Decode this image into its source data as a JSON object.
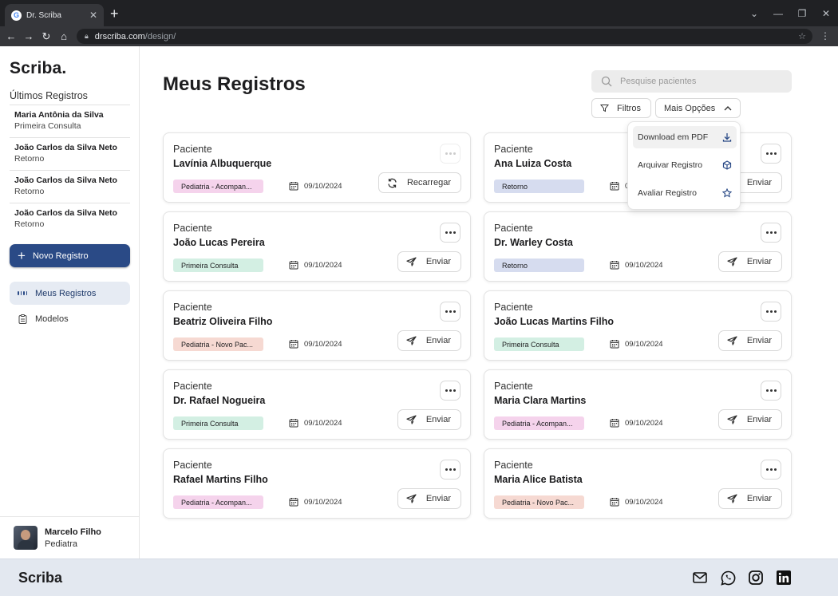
{
  "browser": {
    "tab_title": "Dr. Scriba",
    "tab_favicon": "G",
    "url_domain": "drscriba.com",
    "url_path": "/design/"
  },
  "sidebar": {
    "brand": "Scriba.",
    "recent_title": "Últimos Registros",
    "recent": [
      {
        "name": "Maria Antônia da Silva",
        "sub": "Primeira Consulta"
      },
      {
        "name": "João Carlos da Silva Neto",
        "sub": "Retorno"
      },
      {
        "name": "João Carlos da Silva Neto",
        "sub": "Retorno"
      },
      {
        "name": "João Carlos da Silva Neto",
        "sub": "Retorno"
      }
    ],
    "new_button": "Novo Registro",
    "nav": [
      {
        "label": "Meus Registros",
        "icon": "grid-icon",
        "active": true
      },
      {
        "label": "Modelos",
        "icon": "clipboard-icon",
        "active": false
      }
    ],
    "user": {
      "name": "Marcelo Filho",
      "role": "Pediatra"
    }
  },
  "main": {
    "title": "Meus Registros",
    "search_placeholder": "Pesquise pacientes",
    "filters_label": "Filtros",
    "more_options_label": "Mais Opções",
    "dropdown": [
      {
        "label": "Download em PDF",
        "icon": "download-icon"
      },
      {
        "label": "Arquivar Registro",
        "icon": "box-icon"
      },
      {
        "label": "Avaliar Registro",
        "icon": "star-icon"
      }
    ],
    "card_label": "Paciente",
    "cards": [
      {
        "name": "Lavínia Albuquerque",
        "tag": "Pediatria - Acompan...",
        "tag_type": "pink",
        "date": "09/10/2024",
        "action": "Recarregar"
      },
      {
        "name": "Ana Luiza Costa",
        "tag": "Retorno",
        "tag_type": "blue",
        "date": "09/10/2024",
        "action": "Enviar"
      },
      {
        "name": "João Lucas Pereira",
        "tag": "Primeira Consulta",
        "tag_type": "green",
        "date": "09/10/2024",
        "action": "Enviar"
      },
      {
        "name": "Dr. Warley Costa",
        "tag": "Retorno",
        "tag_type": "blue",
        "date": "09/10/2024",
        "action": "Enviar"
      },
      {
        "name": "Beatriz Oliveira Filho",
        "tag": "Pediatria - Novo Pac...",
        "tag_type": "salmon",
        "date": "09/10/2024",
        "action": "Enviar"
      },
      {
        "name": "João Lucas Martins Filho",
        "tag": "Primeira Consulta",
        "tag_type": "green",
        "date": "09/10/2024",
        "action": "Enviar"
      },
      {
        "name": "Dr. Rafael Nogueira",
        "tag": "Primeira Consulta",
        "tag_type": "green",
        "date": "09/10/2024",
        "action": "Enviar"
      },
      {
        "name": "Maria Clara Martins",
        "tag": "Pediatria - Acompan...",
        "tag_type": "pink",
        "date": "09/10/2024",
        "action": "Enviar"
      },
      {
        "name": "Rafael Martins Filho",
        "tag": "Pediatria - Acompan...",
        "tag_type": "pink",
        "date": "09/10/2024",
        "action": "Enviar"
      },
      {
        "name": "Maria Alice Batista",
        "tag": "Pediatria - Novo Pac...",
        "tag_type": "salmon",
        "date": "09/10/2024",
        "action": "Enviar"
      }
    ]
  },
  "footer": {
    "brand": "Scriba",
    "icons": [
      "mail-icon",
      "whatsapp-icon",
      "instagram-icon",
      "linkedin-icon"
    ]
  },
  "colors": {
    "primary": "#2a4a86",
    "tag_pink": "#f5d3ec",
    "tag_blue": "#d6dcef",
    "tag_green": "#d3efe3",
    "tag_salmon": "#f6d9d2",
    "footer_bg": "#e3e8f0"
  }
}
